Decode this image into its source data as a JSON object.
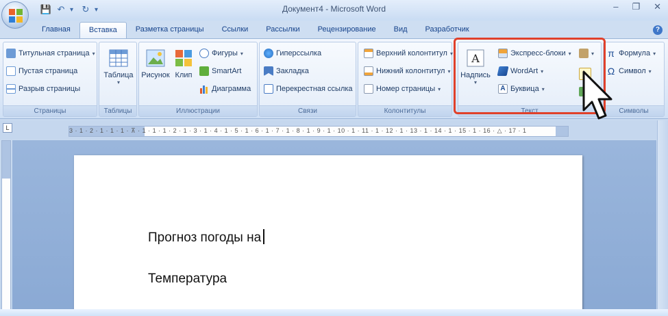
{
  "window": {
    "title": "Документ4 - Microsoft Word",
    "controls": {
      "minimize": "–",
      "restore": "❐",
      "close": "✕"
    }
  },
  "qat": {
    "save": "💾",
    "undo": "↶",
    "redo": "↻",
    "more": "▾"
  },
  "tabs": [
    "Главная",
    "Вставка",
    "Разметка страницы",
    "Ссылки",
    "Рассылки",
    "Рецензирование",
    "Вид",
    "Разработчик"
  ],
  "active_tab": "Вставка",
  "help": "?",
  "ribbon": {
    "pages": {
      "label": "Страницы",
      "items": [
        "Титульная страница",
        "Пустая страница",
        "Разрыв страницы"
      ]
    },
    "tables": {
      "label": "Таблицы",
      "button": "Таблица"
    },
    "illustrations": {
      "label": "Иллюстрации",
      "picture": "Рисунок",
      "clip": "Клип",
      "items": [
        "Фигуры",
        "SmartArt",
        "Диаграмма"
      ]
    },
    "links": {
      "label": "Связи",
      "items": [
        "Гиперссылка",
        "Закладка",
        "Перекрестная ссылка"
      ]
    },
    "header_footer": {
      "label": "Колонтитулы",
      "items": [
        "Верхний колонтитул",
        "Нижний колонтитул",
        "Номер страницы"
      ]
    },
    "text": {
      "label": "Текст",
      "textbox": "Надпись",
      "items": [
        "Экспресс-блоки",
        "WordArt",
        "Буквица"
      ]
    },
    "symbols": {
      "label": "Символы",
      "items": [
        "Формула",
        "Символ"
      ]
    }
  },
  "ruler": {
    "corner": "L",
    "numbers": "3 · 1 · 2 · 1 · 1 · 1 · ⊼ · 1 · 1 · 1 · 2 · 1 · 3 · 1 · 4 · 1 · 5 · 1 · 6 · 1 · 7 · 1 · 8 · 1 · 9 · 1 · 10 · 1 · 11 · 1 · 12 · 1 · 13 · 1 · 14 · 1 · 15 · 1 · 16 · △ · 17 · 1"
  },
  "document": {
    "line1": "Прогноз погоды на",
    "line2": "Температура"
  },
  "colors": {
    "highlight": "#e0402a",
    "ribbon_text": "#1f3c66",
    "tab_text": "#15428b"
  }
}
